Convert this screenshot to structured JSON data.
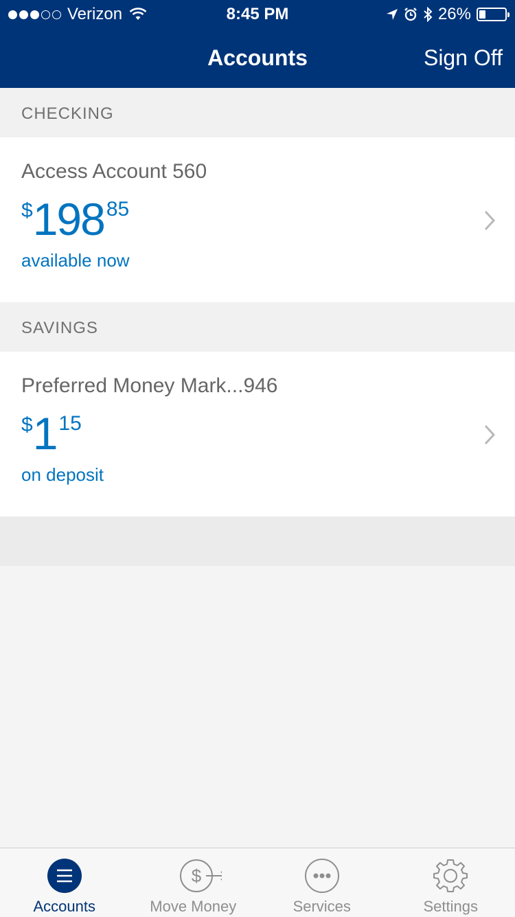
{
  "status_bar": {
    "carrier": "Verizon",
    "time": "8:45 PM",
    "battery_percent": "26%",
    "battery_level": 0.26,
    "signal_bars_filled": 3,
    "signal_bars_total": 5
  },
  "nav": {
    "title": "Accounts",
    "sign_off": "Sign Off"
  },
  "sections": [
    {
      "header": "CHECKING",
      "account": {
        "name": "Access Account 560",
        "currency": "$",
        "dollars": "198",
        "cents": "85",
        "subtitle": "available now"
      }
    },
    {
      "header": "SAVINGS",
      "account": {
        "name": "Preferred Money Mark...946",
        "currency": "$",
        "dollars": "1",
        "cents": "15",
        "subtitle": "on deposit"
      }
    }
  ],
  "tabs": [
    {
      "label": "Accounts",
      "icon": "menu-icon",
      "active": true
    },
    {
      "label": "Move Money",
      "icon": "move-money-icon",
      "active": false
    },
    {
      "label": "Services",
      "icon": "more-icon",
      "active": false
    },
    {
      "label": "Settings",
      "icon": "gear-icon",
      "active": false
    }
  ],
  "colors": {
    "header_bg": "#003478",
    "accent": "#0274c0",
    "tab_active": "#003478",
    "tab_inactive": "#8e8e8e"
  }
}
